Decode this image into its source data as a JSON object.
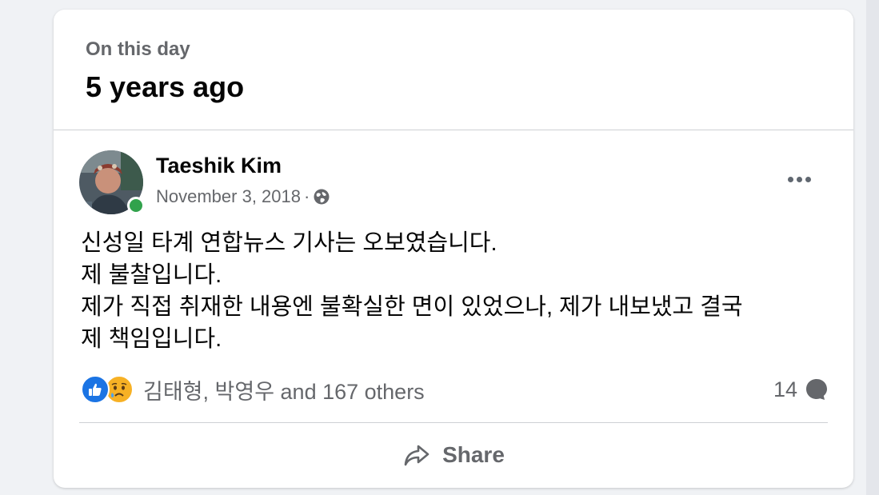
{
  "header": {
    "label": "On this day",
    "title": "5 years ago"
  },
  "post": {
    "author": "Taeshik Kim",
    "date": "November 3, 2018",
    "separator": "·",
    "audience_icon": "globe-icon",
    "online": true,
    "body_lines": [
      "신성일 타계 연합뉴스 기사는 오보였습니다.",
      "제 불찰입니다.",
      "제가 직접 취재한 내용엔 불확실한 면이 있었으나, 제가 내보냈고 결국",
      "제 책임입니다."
    ],
    "reactions": {
      "icons": [
        "like-icon",
        "sad-icon"
      ],
      "summary": "김태형, 박영우 and 167 others"
    },
    "comments_count": "14",
    "share_label": "Share"
  },
  "colors": {
    "accent_like": "#1b74e4",
    "sad": "#f7b125",
    "online": "#31a24c",
    "secondary_text": "#65676b",
    "page_bg": "#f0f2f5"
  }
}
